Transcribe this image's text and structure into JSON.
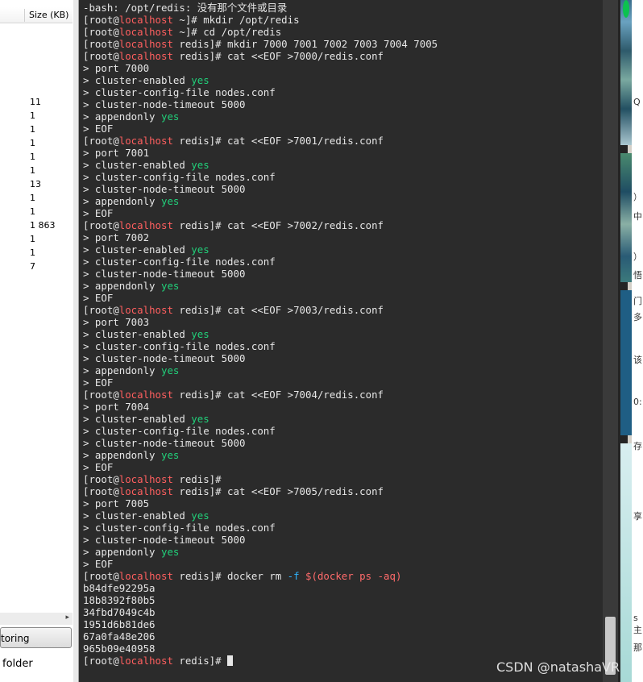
{
  "left_panel": {
    "size_header": "Size (KB)",
    "sizes": [
      "11",
      "1",
      "1",
      "1",
      "1",
      "1",
      "13",
      "1",
      "1",
      "1 863",
      "1",
      "1",
      "7"
    ],
    "restoring_button": "toring",
    "folder_label": "folder"
  },
  "terminal": {
    "lines": [
      [
        {
          "t": "-bash: /opt/redis: 没有那个文件或目录",
          "c": ""
        }
      ],
      [
        {
          "t": "[root@",
          "c": ""
        },
        {
          "t": "localhost",
          "c": "host"
        },
        {
          "t": " ~]# mkdir /opt/redis",
          "c": ""
        }
      ],
      [
        {
          "t": "[root@",
          "c": ""
        },
        {
          "t": "localhost",
          "c": "host"
        },
        {
          "t": " ~]# cd /opt/redis",
          "c": ""
        }
      ],
      [
        {
          "t": "[root@",
          "c": ""
        },
        {
          "t": "localhost",
          "c": "host"
        },
        {
          "t": " redis]# mkdir 7000 7001 7002 7003 7004 7005",
          "c": ""
        }
      ],
      [
        {
          "t": "[root@",
          "c": ""
        },
        {
          "t": "localhost",
          "c": "host"
        },
        {
          "t": " redis]# cat <<EOF >7000/redis.conf",
          "c": ""
        }
      ],
      [
        {
          "t": "> port 7000",
          "c": ""
        }
      ],
      [
        {
          "t": "> cluster-enabled ",
          "c": ""
        },
        {
          "t": "yes",
          "c": "yes"
        }
      ],
      [
        {
          "t": "> cluster-config-file nodes.conf",
          "c": ""
        }
      ],
      [
        {
          "t": "> cluster-node-timeout 5000",
          "c": ""
        }
      ],
      [
        {
          "t": "> appendonly ",
          "c": ""
        },
        {
          "t": "yes",
          "c": "yes"
        }
      ],
      [
        {
          "t": "> EOF",
          "c": ""
        }
      ],
      [
        {
          "t": "[root@",
          "c": ""
        },
        {
          "t": "localhost",
          "c": "host"
        },
        {
          "t": " redis]# cat <<EOF >7001/redis.conf",
          "c": ""
        }
      ],
      [
        {
          "t": "> port 7001",
          "c": ""
        }
      ],
      [
        {
          "t": "> cluster-enabled ",
          "c": ""
        },
        {
          "t": "yes",
          "c": "yes"
        }
      ],
      [
        {
          "t": "> cluster-config-file nodes.conf",
          "c": ""
        }
      ],
      [
        {
          "t": "> cluster-node-timeout 5000",
          "c": ""
        }
      ],
      [
        {
          "t": "> appendonly ",
          "c": ""
        },
        {
          "t": "yes",
          "c": "yes"
        }
      ],
      [
        {
          "t": "> EOF",
          "c": ""
        }
      ],
      [
        {
          "t": "[root@",
          "c": ""
        },
        {
          "t": "localhost",
          "c": "host"
        },
        {
          "t": " redis]# cat <<EOF >7002/redis.conf",
          "c": ""
        }
      ],
      [
        {
          "t": "> port 7002",
          "c": ""
        }
      ],
      [
        {
          "t": "> cluster-enabled ",
          "c": ""
        },
        {
          "t": "yes",
          "c": "yes"
        }
      ],
      [
        {
          "t": "> cluster-config-file nodes.conf",
          "c": ""
        }
      ],
      [
        {
          "t": "> cluster-node-timeout 5000",
          "c": ""
        }
      ],
      [
        {
          "t": "> appendonly ",
          "c": ""
        },
        {
          "t": "yes",
          "c": "yes"
        }
      ],
      [
        {
          "t": "> EOF",
          "c": ""
        }
      ],
      [
        {
          "t": "[root@",
          "c": ""
        },
        {
          "t": "localhost",
          "c": "host"
        },
        {
          "t": " redis]# cat <<EOF >7003/redis.conf",
          "c": ""
        }
      ],
      [
        {
          "t": "> port 7003",
          "c": ""
        }
      ],
      [
        {
          "t": "> cluster-enabled ",
          "c": ""
        },
        {
          "t": "yes",
          "c": "yes"
        }
      ],
      [
        {
          "t": "> cluster-config-file nodes.conf",
          "c": ""
        }
      ],
      [
        {
          "t": "> cluster-node-timeout 5000",
          "c": ""
        }
      ],
      [
        {
          "t": "> appendonly ",
          "c": ""
        },
        {
          "t": "yes",
          "c": "yes"
        }
      ],
      [
        {
          "t": "> EOF",
          "c": ""
        }
      ],
      [
        {
          "t": "[root@",
          "c": ""
        },
        {
          "t": "localhost",
          "c": "host"
        },
        {
          "t": " redis]# cat <<EOF >7004/redis.conf",
          "c": ""
        }
      ],
      [
        {
          "t": "> port 7004",
          "c": ""
        }
      ],
      [
        {
          "t": "> cluster-enabled ",
          "c": ""
        },
        {
          "t": "yes",
          "c": "yes"
        }
      ],
      [
        {
          "t": "> cluster-config-file nodes.conf",
          "c": ""
        }
      ],
      [
        {
          "t": "> cluster-node-timeout 5000",
          "c": ""
        }
      ],
      [
        {
          "t": "> appendonly ",
          "c": ""
        },
        {
          "t": "yes",
          "c": "yes"
        }
      ],
      [
        {
          "t": "> EOF",
          "c": ""
        }
      ],
      [
        {
          "t": "[root@",
          "c": ""
        },
        {
          "t": "localhost",
          "c": "host"
        },
        {
          "t": " redis]#",
          "c": ""
        }
      ],
      [
        {
          "t": "[root@",
          "c": ""
        },
        {
          "t": "localhost",
          "c": "host"
        },
        {
          "t": " redis]# cat <<EOF >7005/redis.conf",
          "c": ""
        }
      ],
      [
        {
          "t": "> port 7005",
          "c": ""
        }
      ],
      [
        {
          "t": "> cluster-enabled ",
          "c": ""
        },
        {
          "t": "yes",
          "c": "yes"
        }
      ],
      [
        {
          "t": "> cluster-config-file nodes.conf",
          "c": ""
        }
      ],
      [
        {
          "t": "> cluster-node-timeout 5000",
          "c": ""
        }
      ],
      [
        {
          "t": "> appendonly ",
          "c": ""
        },
        {
          "t": "yes",
          "c": "yes"
        }
      ],
      [
        {
          "t": "> EOF",
          "c": ""
        }
      ],
      [
        {
          "t": "[root@",
          "c": ""
        },
        {
          "t": "localhost",
          "c": "host"
        },
        {
          "t": " redis]# docker rm ",
          "c": ""
        },
        {
          "t": "-f",
          "c": "flag"
        },
        {
          "t": " ",
          "c": ""
        },
        {
          "t": "$(docker ps -aq)",
          "c": "sub"
        }
      ],
      [
        {
          "t": "b84dfe92295a",
          "c": ""
        }
      ],
      [
        {
          "t": "18b8392f80b5",
          "c": ""
        }
      ],
      [
        {
          "t": "34fbd7049c4b",
          "c": ""
        }
      ],
      [
        {
          "t": "1951d6b81de6",
          "c": ""
        }
      ],
      [
        {
          "t": "67a0fa48e206",
          "c": ""
        }
      ],
      [
        {
          "t": "965b09e40958",
          "c": ""
        }
      ],
      [
        {
          "t": "[root@",
          "c": ""
        },
        {
          "t": "localhost",
          "c": "host"
        },
        {
          "t": " redis]# ",
          "c": ""
        }
      ]
    ]
  },
  "right_panel": {
    "glyphs": [
      "Q",
      "）",
      "中",
      "）",
      "悟",
      "门",
      "多",
      "该",
      "0:",
      "存",
      "享",
      "s主",
      "那"
    ]
  },
  "watermark": "CSDN @natashaVR",
  "colors": {
    "terminal_bg": "#2b2b2b",
    "terminal_fg": "#e6e6e6",
    "host": "#ff5f5f",
    "yes": "#21d07a"
  }
}
